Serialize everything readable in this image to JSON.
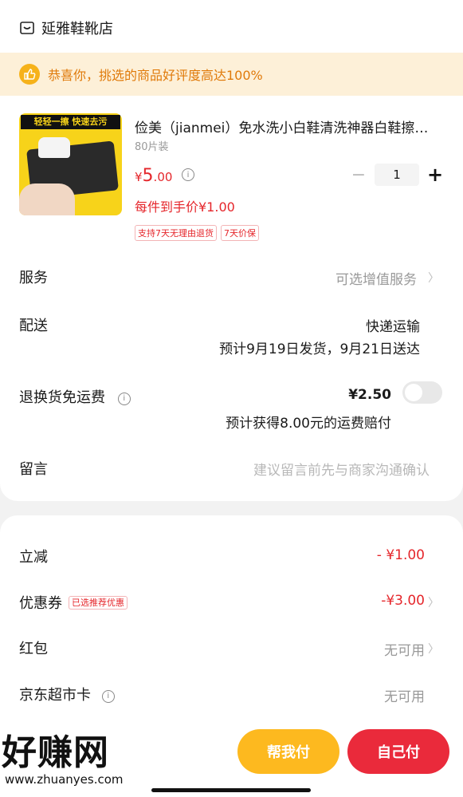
{
  "store": {
    "name": "延雅鞋靴店",
    "icon": "store-icon"
  },
  "praise_banner": {
    "text": "恭喜你，挑选的商品好评度高达100%",
    "icon": "thumbs-up-icon"
  },
  "product": {
    "image_banner": "轻轻一擦 快速去污",
    "title": "俭美（jianmei）免水洗小白鞋清洗神器白鞋擦鞋湿巾",
    "spec": "80片装",
    "price_symbol": "¥",
    "price_int": "5",
    "price_dec": ".00",
    "final_price": "每件到手价¥1.00",
    "tags": [
      "支持7天无理由退货",
      "7天价保"
    ],
    "quantity": "1",
    "minus": "−",
    "plus": "+"
  },
  "rows": {
    "service": {
      "label": "服务",
      "value": "可选增值服务"
    },
    "delivery": {
      "label": "配送",
      "method": "快递运输",
      "eta": "预计9月19日发货，9月21日送达"
    },
    "return_shipping": {
      "label": "退换货免运费",
      "price": "¥2.50",
      "note": "预计获得8.00元的运费赔付",
      "toggle_on": false
    },
    "message": {
      "label": "留言",
      "placeholder": "建议留言前先与商家沟通确认"
    }
  },
  "discounts": {
    "instant": {
      "label": "立减",
      "value": "- ¥1.00"
    },
    "coupon": {
      "label": "优惠券",
      "tag": "已选推荐优惠",
      "value": "-¥3.00"
    },
    "red_packet": {
      "label": "红包",
      "value": "无可用"
    },
    "market_card": {
      "label": "京东超市卡",
      "value": "无可用"
    }
  },
  "bottom": {
    "help_pay": "帮我付",
    "self_pay": "自己付",
    "watermark": "好赚网",
    "watermark_url": "www.zhuanyes.com"
  },
  "colors": {
    "accent": "#e5262b",
    "help_button": "#fdb91f",
    "self_button": "#ea2a3b",
    "banner_bg": "#fdf0d8"
  }
}
